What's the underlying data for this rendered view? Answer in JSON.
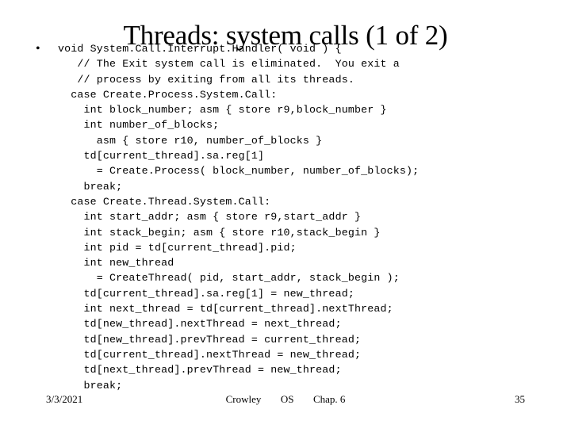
{
  "slide": {
    "title": "Threads: system calls (1 of 2)",
    "bullet_glyph": "•",
    "code_lines": [
      "void System.Call.Interrupt.Handler( void ) {",
      "   // The Exit system call is eliminated.  You exit a",
      "   // process by exiting from all its threads.",
      "  case Create.Process.System.Call:",
      "    int block_number; asm { store r9,block_number }",
      "    int number_of_blocks;",
      "      asm { store r10, number_of_blocks }",
      "    td[current_thread].sa.reg[1]",
      "      = Create.Process( block_number, number_of_blocks);",
      "    break;",
      "  case Create.Thread.System.Call:",
      "    int start_addr; asm { store r9,start_addr }",
      "    int stack_begin; asm { store r10,stack_begin }",
      "    int pid = td[current_thread].pid;",
      "    int new_thread",
      "      = CreateThread( pid, start_addr, stack_begin );",
      "    td[current_thread].sa.reg[1] = new_thread;",
      "    int next_thread = td[current_thread].nextThread;",
      "    td[new_thread].nextThread = next_thread;",
      "    td[new_thread].prevThread = current_thread;",
      "    td[current_thread].nextThread = new_thread;",
      "    td[next_thread].prevThread = new_thread;",
      "    break;"
    ]
  },
  "footer": {
    "date": "3/3/2021",
    "author": "Crowley",
    "course": "OS",
    "chapter": "Chap. 6",
    "page_number": "35"
  },
  "colors": {
    "background": "#ffffff",
    "text": "#000000"
  }
}
